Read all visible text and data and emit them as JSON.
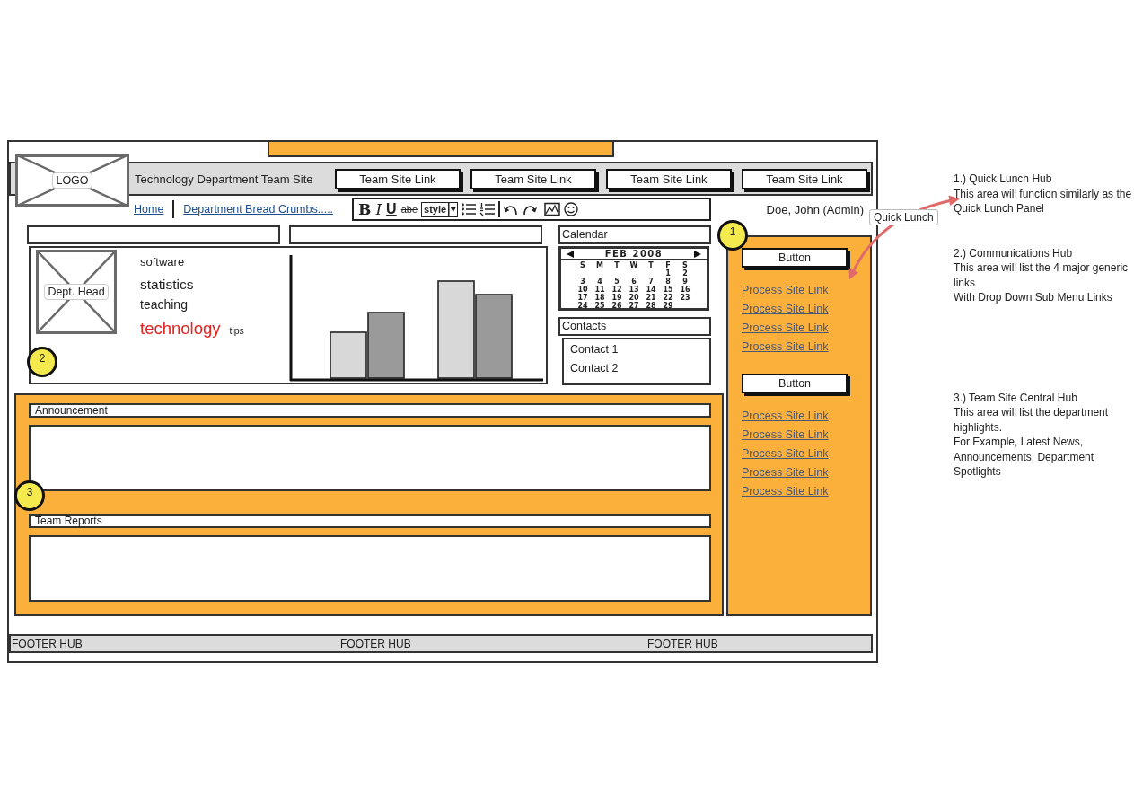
{
  "header": {
    "logo": "LOGO",
    "title": "Technology Department Team Site",
    "links": [
      "Team Site Link",
      "Team Site Link",
      "Team Site Link",
      "Team Site Link"
    ]
  },
  "nav": {
    "breadcrumbs": [
      "Home",
      "Department Bread Crumbs....."
    ],
    "user": "Doe, John (Admin)"
  },
  "editor_toolbar": {
    "format_buttons": [
      {
        "label": "B",
        "kind": "bold"
      },
      {
        "label": "I",
        "kind": "italic"
      },
      {
        "label": "U",
        "kind": "underline"
      },
      {
        "label": "abe",
        "kind": "strike"
      }
    ],
    "style_dropdown": {
      "value": "style"
    }
  },
  "profile_panel": {
    "marker": "2",
    "photo_label": "Dept. Head",
    "tag_cloud": [
      [
        {
          "text": "software"
        }
      ],
      [
        {
          "text": "statistics"
        }
      ],
      [
        {
          "text": "teaching"
        }
      ],
      [
        {
          "text": "technology",
          "color": "#e5231e"
        },
        {
          "text": "tips"
        }
      ]
    ]
  },
  "calendar": {
    "title": "Calendar",
    "month": "FEB 2008",
    "weekdays": [
      "S",
      "M",
      "T",
      "W",
      "T",
      "F",
      "S"
    ],
    "weeks": [
      [
        "1",
        "2"
      ],
      [
        "3",
        "4",
        "5",
        "6",
        "7",
        "8",
        "9"
      ],
      [
        "10",
        "11",
        "12",
        "13",
        "14",
        "15",
        "16"
      ],
      [
        "17",
        "18",
        "19",
        "20",
        "21",
        "22",
        "23"
      ],
      [
        "24",
        "25",
        "26",
        "27",
        "28",
        "29"
      ]
    ]
  },
  "contacts": {
    "title": "Contacts",
    "items": [
      "Contact 1",
      "Contact 2"
    ]
  },
  "central_hub": {
    "marker": "3",
    "sections": [
      {
        "title": "Announcement"
      },
      {
        "title": "Team Reports"
      }
    ]
  },
  "quick_lunch_panel": {
    "marker": "1",
    "groups": [
      {
        "button": "Button",
        "links": [
          "Process Site Link",
          "Process Site Link",
          "Process Site Link",
          "Process Site Link"
        ]
      },
      {
        "button": "Button",
        "links": [
          "Process Site Link",
          "Process Site Link",
          "Process Site Link",
          "Process Site Link",
          "Process Site Link"
        ]
      }
    ]
  },
  "footer": {
    "items": [
      "FOOTER HUB",
      "FOOTER HUB",
      "FOOTER HUB"
    ]
  },
  "callout_label": "Quick Lunch",
  "annotations": [
    {
      "title": "1.) Quick Lunch Hub",
      "body": [
        "This area will function similarly as the Quick Lunch Panel"
      ]
    },
    {
      "title": "2.) Communications Hub",
      "body": [
        "This area will list the 4 major generic links",
        "With Drop Down Sub Menu Links"
      ]
    },
    {
      "title": "3.) Team Site Central Hub",
      "body": [
        "This area will list the department highlights.",
        "For Example, Latest News, Announcements, Department Spotlights"
      ]
    }
  ]
}
